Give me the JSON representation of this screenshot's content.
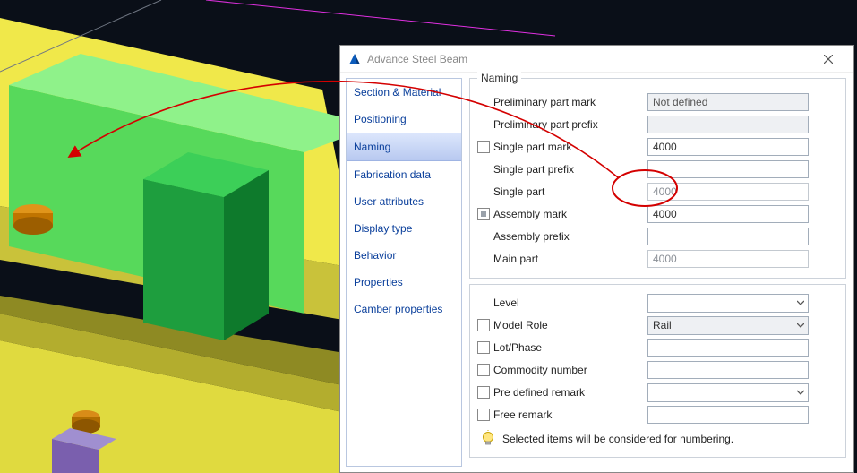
{
  "dialog": {
    "title": "Advance Steel   Beam",
    "nav": {
      "items": [
        {
          "label": "Section & Material"
        },
        {
          "label": "Positioning"
        },
        {
          "label": "Naming",
          "selected": true
        },
        {
          "label": "Fabrication data"
        },
        {
          "label": "User attributes"
        },
        {
          "label": "Display type"
        },
        {
          "label": "Behavior"
        },
        {
          "label": "Properties"
        },
        {
          "label": "Camber properties"
        }
      ]
    },
    "group1": {
      "title": "Naming",
      "rows": {
        "prelim_mark": {
          "label": "Preliminary part mark",
          "value": "Not defined",
          "readonly": true,
          "placeholder": ""
        },
        "prelim_prefix": {
          "label": "Preliminary part prefix",
          "value": "",
          "readonly": true
        },
        "single_mark": {
          "label": "Single part mark",
          "value": "4000",
          "checkbox": true,
          "checked": false
        },
        "single_prefix": {
          "label": "Single part prefix",
          "value": ""
        },
        "single_part": {
          "label": "Single part",
          "value": "4000",
          "readonly": true
        },
        "asm_mark": {
          "label": "Assembly mark",
          "value": "4000",
          "checkbox": true,
          "checked": "dot"
        },
        "asm_prefix": {
          "label": "Assembly prefix",
          "value": ""
        },
        "main_part": {
          "label": "Main part",
          "value": "4000",
          "readonly": true
        }
      }
    },
    "group2": {
      "rows": {
        "level": {
          "label": "Level",
          "type": "combo",
          "value": ""
        },
        "model_role": {
          "label": "Model Role",
          "type": "combo",
          "value": "Rail",
          "checkbox": true
        },
        "lot_phase": {
          "label": "Lot/Phase",
          "type": "text",
          "value": "",
          "checkbox": true
        },
        "commodity": {
          "label": "Commodity number",
          "type": "text",
          "value": "",
          "checkbox": true
        },
        "predef_remark": {
          "label": "Pre defined remark",
          "type": "combo",
          "value": "",
          "checkbox": true
        },
        "free_remark": {
          "label": "Free remark",
          "type": "text",
          "value": "",
          "checkbox": true
        }
      }
    },
    "footer_note": "Selected items will be considered for numbering."
  },
  "annotation": {
    "color": "#d40000"
  },
  "colors": {
    "viewport_bg": "#0a0f18",
    "nav_link": "#0a3f9b"
  }
}
